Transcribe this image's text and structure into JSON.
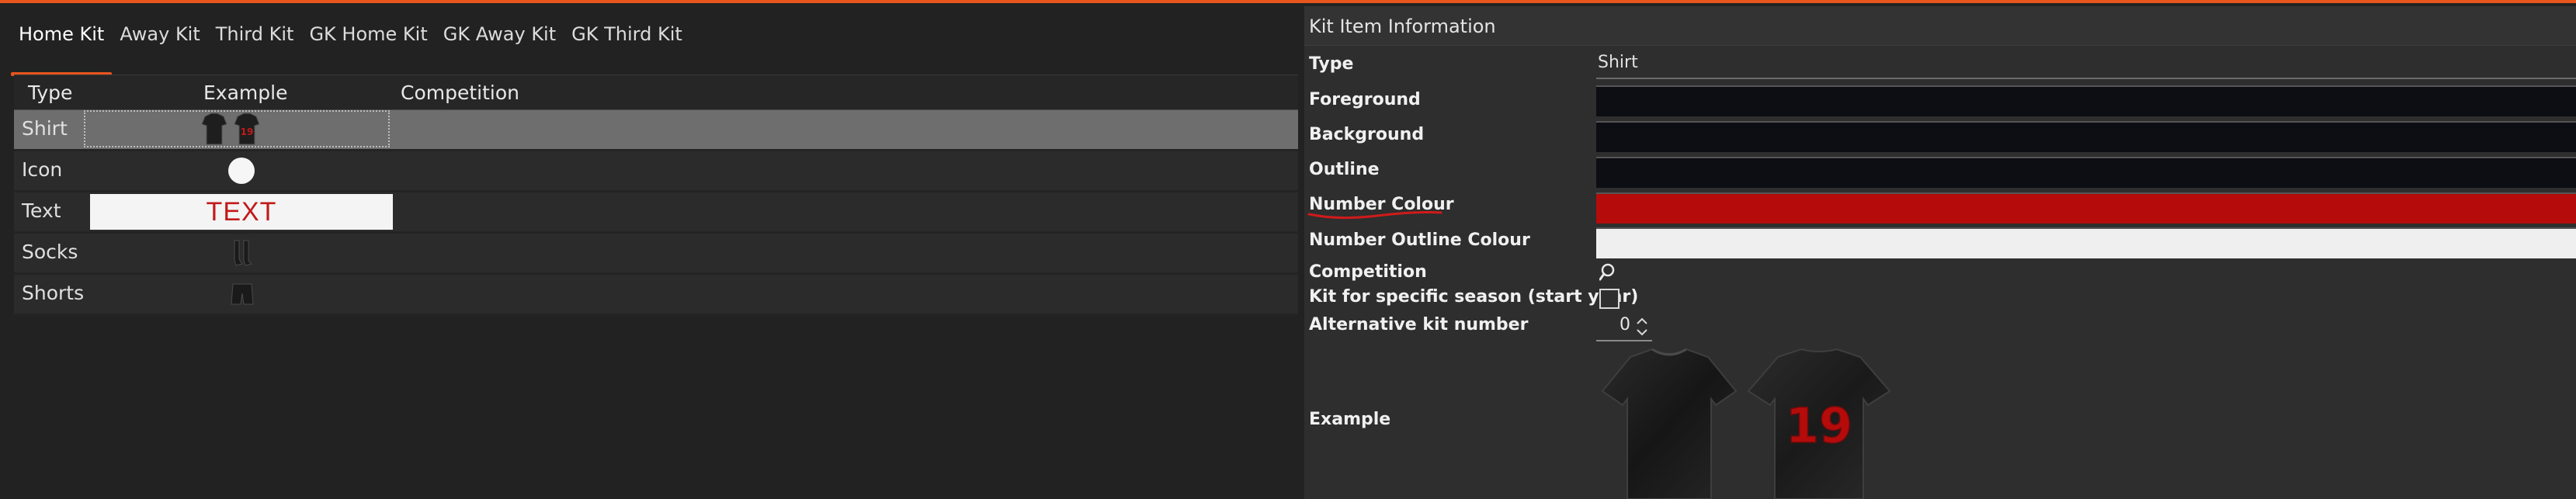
{
  "tabs": [
    {
      "label": "Home Kit",
      "active": true
    },
    {
      "label": "Away Kit",
      "active": false
    },
    {
      "label": "Third Kit",
      "active": false
    },
    {
      "label": "GK Home Kit",
      "active": false
    },
    {
      "label": "GK Away Kit",
      "active": false
    },
    {
      "label": "GK Third Kit",
      "active": false
    }
  ],
  "table": {
    "headers": {
      "type": "Type",
      "example": "Example",
      "competition": "Competition"
    },
    "rows": [
      {
        "type": "Shirt",
        "example_icon": "shirt-pair-icon",
        "competition": "",
        "selected": true
      },
      {
        "type": "Icon",
        "example_icon": "white-circle-icon",
        "competition": "",
        "selected": false
      },
      {
        "type": "Text",
        "example_text": "TEXT",
        "competition": "",
        "selected": false
      },
      {
        "type": "Socks",
        "example_icon": "socks-icon",
        "competition": "",
        "selected": false
      },
      {
        "type": "Shorts",
        "example_icon": "shorts-icon",
        "competition": "",
        "selected": false
      }
    ]
  },
  "panel": {
    "title": "Kit Item Information",
    "fields": {
      "type_label": "Type",
      "type_value": "Shirt",
      "foreground_label": "Foreground",
      "background_label": "Background",
      "outline_label": "Outline",
      "number_colour_label": "Number Colour",
      "number_outline_colour_label": "Number Outline Colour",
      "competition_label": "Competition",
      "season_label": "Kit for specific season (start year)",
      "alt_kit_label": "Alternative kit number",
      "alt_kit_value": "0",
      "example_label": "Example",
      "shirt_number": "19"
    },
    "colors": {
      "foreground": "#0d0d14",
      "background": "#0d0d14",
      "outline": "#0d0d14",
      "number_colour": "#b50b0b",
      "number_outline_colour": "#efefef"
    },
    "season_checked": false
  },
  "accent": "#e8551d"
}
